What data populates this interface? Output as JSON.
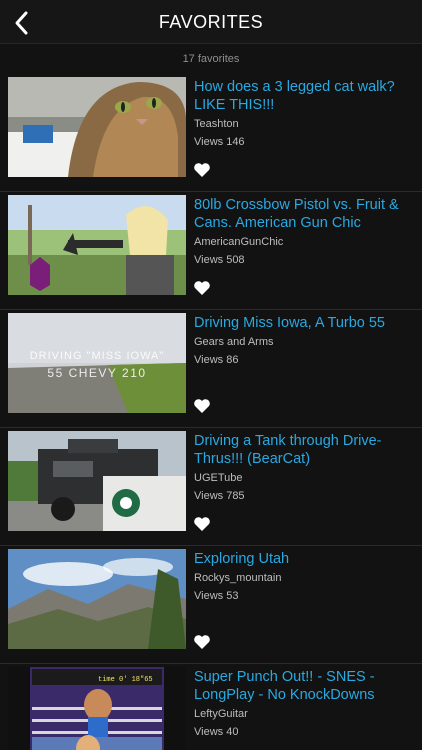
{
  "navbar": {
    "title": "FAVORITES"
  },
  "favorites_count": "17 favorites",
  "items": [
    {
      "title": "How does a 3 legged cat walk? LIKE THIS!!!",
      "author": "Teashton",
      "views": "Views 146"
    },
    {
      "title": "80lb Crossbow Pistol vs. Fruit & Cans.   American Gun Chic experim…",
      "author": "AmericanGunChic",
      "views": "Views 508"
    },
    {
      "title": "Driving Miss Iowa, A Turbo 55",
      "author": "Gears and Arms",
      "views": "Views 86"
    },
    {
      "title": "Driving a Tank through Drive-Thrus!!! (BearCat)",
      "author": "UGETube",
      "views": "Views 785"
    },
    {
      "title": "Exploring Utah",
      "author": "Rockys_mountain",
      "views": "Views 53"
    },
    {
      "title": "Super Punch Out!! - SNES - LongPlay - No KnockDowns",
      "author": "LeftyGuitar",
      "views": "Views 40"
    }
  ],
  "thumb_overlays": {
    "iowa_line1": "DRIVING \"MISS IOWA\"",
    "iowa_line2": "55 CHEVY 210",
    "game_hud": "time 0' 18\"65"
  },
  "colors": {
    "accent": "#29a9e1",
    "background": "#121212"
  }
}
